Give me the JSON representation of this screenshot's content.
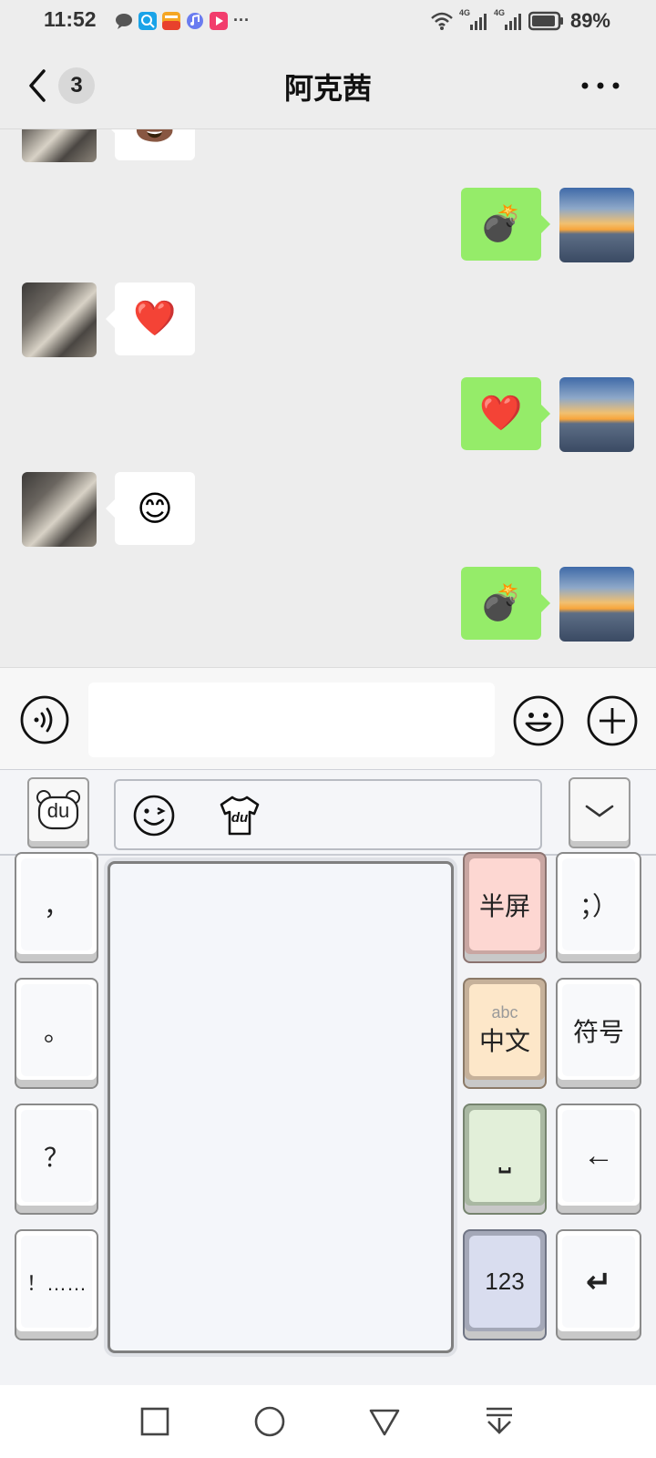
{
  "status_bar": {
    "time": "11:52",
    "more_dots": "···",
    "network_1": "4G",
    "network_2": "4G",
    "battery": "89%"
  },
  "header": {
    "back_count": "3",
    "title": "阿克茜",
    "more_icon": "more-dots-icon"
  },
  "messages": [
    {
      "side": "in",
      "emoji": "poop-emoji",
      "glyph": "💩"
    },
    {
      "side": "out",
      "emoji": "bomb-emoji",
      "glyph": "💣"
    },
    {
      "side": "in",
      "emoji": "heart-emoji",
      "glyph": "❤️"
    },
    {
      "side": "out",
      "emoji": "heart-emoji",
      "glyph": "❤️"
    },
    {
      "side": "in",
      "emoji": "smile-emoji",
      "glyph": "😊"
    },
    {
      "side": "out",
      "emoji": "bomb-emoji",
      "glyph": "💣"
    }
  ],
  "input": {
    "value": "",
    "voice_icon": "voice-icon",
    "emoji_icon": "emoji-icon",
    "plus_icon": "plus-icon"
  },
  "keyboard": {
    "toolbar": {
      "logo": "du",
      "cand_icon_1": "wink-icon",
      "cand_icon_2_label": "du",
      "collapse_icon": "chevron-down-icon"
    },
    "left_keys": [
      "，",
      "。",
      "？",
      "！……"
    ],
    "right_col1": {
      "half_screen": "半屏",
      "abc_small": "abc",
      "chinese": "中文",
      "space_glyph": "⎵",
      "num": "123"
    },
    "right_col2": {
      "smiley": "；）",
      "symbol": "符号",
      "backspace_glyph": "←",
      "enter_glyph": "↵"
    }
  },
  "colors": {
    "bubble_out": "#95ec69",
    "bubble_in": "#ffffff",
    "key_pink": "#fdd7d2",
    "key_peach": "#fde7c9",
    "key_mint": "#e2efd9",
    "key_lavender": "#d9ddef"
  }
}
